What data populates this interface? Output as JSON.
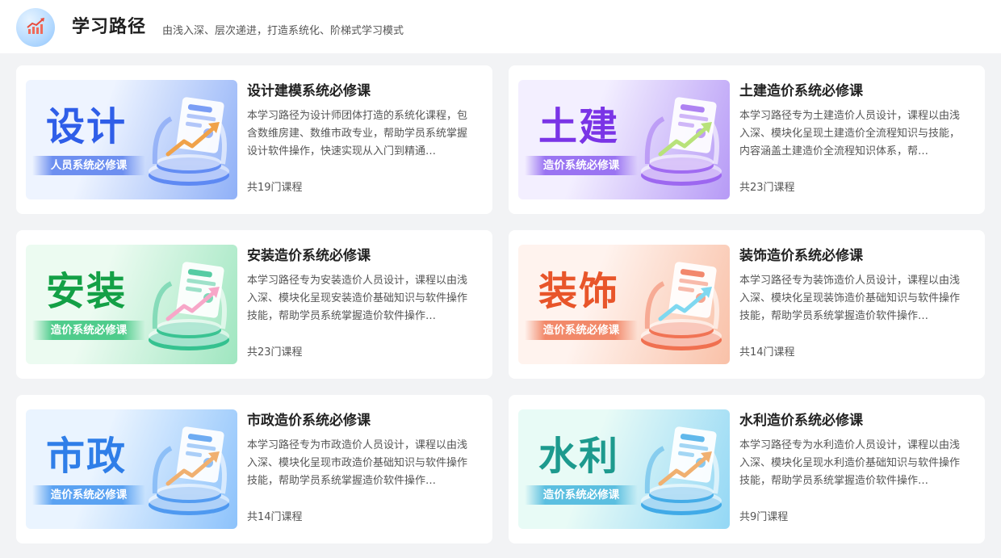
{
  "header": {
    "title": "学习路径",
    "subtitle": "由浅入深、层次递进，打造系统化、阶梯式学习模式",
    "logo_icon": "rising-chart-icon"
  },
  "cards": [
    {
      "banner_title": "设计",
      "banner_label": "人员系统必修课",
      "title": "设计建模系统必修课",
      "description": "本学习路径为设计师团体打造的系统化课程，包含数维房建、数维市政专业，帮助学员系统掌握设计软件操作，快速实现从入门到精通…",
      "count": "共19门课程",
      "theme": {
        "bg1": "#eef4ff",
        "bg2": "#8fb0f7",
        "text": "#2f5ee8",
        "ribbon": "#6d8ff0",
        "disk": "#5a86f2",
        "arrow": "#f0a24a"
      }
    },
    {
      "banner_title": "土建",
      "banner_label": "造价系统必修课",
      "title": "土建造价系统必修课",
      "description": "本学习路径专为土建造价人员设计，课程以由浅入深、模块化呈现土建造价全流程知识与技能，内容涵盖土建造价全流程知识体系，帮…",
      "count": "共23门课程",
      "theme": {
        "bg1": "#f3efff",
        "bg2": "#b69af6",
        "text": "#7a34e6",
        "ribbon": "#9a74f2",
        "disk": "#9a63ef",
        "arrow": "#b8e27a"
      }
    },
    {
      "banner_title": "安装",
      "banner_label": "造价系统必修课",
      "title": "安装造价系统必修课",
      "description": "本学习路径专为安装造价人员设计，课程以由浅入深、模块化呈现安装造价基础知识与软件操作技能，帮助学员系统掌握造价软件操作…",
      "count": "共23门课程",
      "theme": {
        "bg1": "#ecfbf1",
        "bg2": "#9fe6c0",
        "text": "#13a046",
        "ribbon": "#4fcc8c",
        "disk": "#2dbf8c",
        "arrow": "#f7a7c8"
      }
    },
    {
      "banner_title": "装饰",
      "banner_label": "造价系统必修课",
      "title": "装饰造价系统必修课",
      "description": "本学习路径专为装饰造价人员设计，课程以由浅入深、模块化呈现装饰造价基础知识与软件操作技能，帮助学员系统掌握造价软件操作…",
      "count": "共14门课程",
      "theme": {
        "bg1": "#fff3ee",
        "bg2": "#f9c1a8",
        "text": "#e8552a",
        "ribbon": "#f2896a",
        "disk": "#ef6a4a",
        "arrow": "#7fd8f0"
      }
    },
    {
      "banner_title": "市政",
      "banner_label": "造价系统必修课",
      "title": "市政造价系统必修课",
      "description": "本学习路径专为市政造价人员设计，课程以由浅入深、模块化呈现市政造价基础知识与软件操作技能，帮助学员系统掌握造价软件操作…",
      "count": "共14门课程",
      "theme": {
        "bg1": "#eaf4ff",
        "bg2": "#8cc2fb",
        "text": "#2f7ee8",
        "ribbon": "#5aa2f2",
        "disk": "#4a96ef",
        "arrow": "#f0b070"
      }
    },
    {
      "banner_title": "水利",
      "banner_label": "造价系统必修课",
      "title": "水利造价系统必修课",
      "description": "本学习路径专为水利造价人员设计，课程以由浅入深、模块化呈现水利造价基础知识与软件操作技能，帮助学员系统掌握造价软件操作…",
      "count": "共9门课程",
      "theme": {
        "bg1": "#e8fbf6",
        "bg2": "#93d7f5",
        "text": "#1d9a8e",
        "ribbon": "#5bbfe0",
        "disk": "#3aa6e6",
        "arrow": "#f0b070"
      }
    }
  ]
}
